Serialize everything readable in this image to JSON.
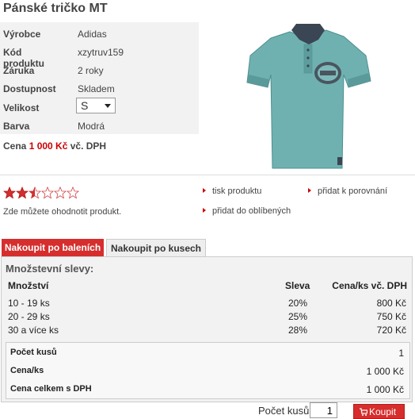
{
  "product": {
    "title": "Pánské tričko MT",
    "specs": [
      {
        "label": "Výrobce",
        "value": "Adidas"
      },
      {
        "label": "Kód produktu",
        "value": "xzytruv159"
      },
      {
        "label": "Záruka",
        "value": "2 roky"
      },
      {
        "label": "Dostupnost",
        "value": "Skladem"
      },
      {
        "label": "Velikost",
        "value": "S"
      },
      {
        "label": "Barva",
        "value": "Modrá"
      }
    ],
    "price_label": "Cena",
    "price_value": "1 000 Kč",
    "price_suffix": "vč. DPH"
  },
  "rating": {
    "stars_filled": 2.5,
    "stars_total": 6,
    "hint": "Zde můžete ohodnotit produkt."
  },
  "links": {
    "print": "tisk produktu",
    "compare": "přidat k porovnání",
    "favorite": "přidat do oblíbených"
  },
  "tabs": {
    "packages": "Nakoupit po baleních",
    "pieces": "Nakoupit po kusech"
  },
  "discounts": {
    "title": "Množstevní slevy:",
    "headers": {
      "qty": "Množství",
      "discount": "Sleva",
      "price": "Cena/ks vč. DPH"
    },
    "rows": [
      {
        "qty": "10 - 19 ks",
        "discount": "20%",
        "price": "800 Kč"
      },
      {
        "qty": "20 - 29 ks",
        "discount": "25%",
        "price": "750 Kč"
      },
      {
        "qty": "30 a více ks",
        "discount": "28%",
        "price": "720 Kč"
      }
    ]
  },
  "summary": {
    "count_label": "Počet kusů",
    "count_value": "1",
    "unit_label": "Cena/ks",
    "unit_value": "1 000 Kč",
    "total_label": "Cena celkem s DPH",
    "total_value": "1 000 Kč"
  },
  "buy": {
    "qty_label": "Počet kusů",
    "qty_value": "1",
    "button": "Koupit"
  },
  "colors": {
    "accent": "#d62d2d",
    "price": "#cc0000",
    "shirt": "#6fb1b1"
  }
}
